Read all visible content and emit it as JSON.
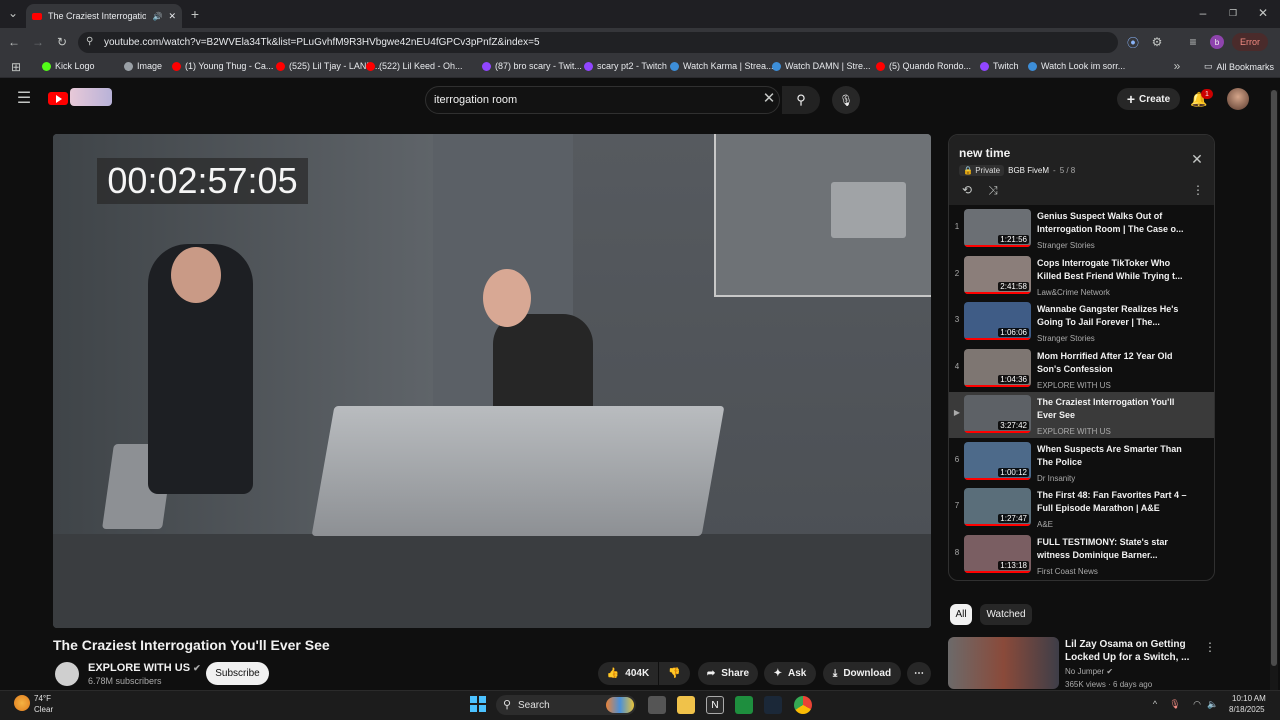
{
  "browser": {
    "tab_title": "The Craziest Interrogation Y",
    "url": "youtube.com/watch?v=B2WVEla34Tk&list=PLuGvhfM9R3HVbgwe42nEU4fGPCv3pPnfZ&index=5",
    "profile_letter": "b",
    "error_label": "Error",
    "bookmarks": [
      {
        "label": "Kick Logo",
        "color": "#53fc18"
      },
      {
        "label": "Image",
        "color": "#9aa0a6"
      },
      {
        "label": "(1) Young Thug - Ca...",
        "color": "#ff0000"
      },
      {
        "label": "(525) Lil Tjay - LANE...",
        "color": "#ff0000"
      },
      {
        "label": "(522) Lil Keed - Oh...",
        "color": "#ff0000"
      },
      {
        "label": "(87) bro scary - Twit...",
        "color": "#9146ff"
      },
      {
        "label": "scary pt2 - Twitch",
        "color": "#9146ff"
      },
      {
        "label": "Watch Karma | Strea...",
        "color": "#3d8ed8"
      },
      {
        "label": "Watch DAMN | Stre...",
        "color": "#3d8ed8"
      },
      {
        "label": "(5) Quando Rondo...",
        "color": "#ff0000"
      },
      {
        "label": "Twitch",
        "color": "#9146ff"
      },
      {
        "label": "Watch Look im sorr...",
        "color": "#3d8ed8"
      }
    ],
    "all_bookmarks": "All Bookmarks"
  },
  "youtube": {
    "search_value": "iterrogation room",
    "create_label": "Create",
    "notification_count": "1"
  },
  "video": {
    "timecode": "00:02:57:05",
    "title": "The Craziest Interrogation You'll Ever See",
    "channel": "EXPLORE WITH US",
    "subscribers": "6.78M subscribers",
    "subscribe_label": "Subscribe",
    "likes": "404K",
    "share_label": "Share",
    "ask_label": "Ask",
    "download_label": "Download"
  },
  "playlist": {
    "title": "new time",
    "privacy": "Private",
    "owner": "BGB FiveM",
    "position": "5 / 8",
    "items": [
      {
        "num": "1",
        "title": "Genius Suspect Walks Out of Interrogation Room | The Case o...",
        "channel": "Stranger Stories",
        "duration": "1:21:56",
        "thumb": "#6b6f74"
      },
      {
        "num": "2",
        "title": "Cops Interrogate TikToker Who Killed Best Friend While Trying t...",
        "channel": "Law&Crime Network",
        "duration": "2:41:58",
        "thumb": "#8b7e7a"
      },
      {
        "num": "3",
        "title": "Wannabe Gangster Realizes He's Going To Jail Forever | The...",
        "channel": "Stranger Stories",
        "duration": "1:06:06",
        "thumb": "#3f5c86"
      },
      {
        "num": "4",
        "title": "Mom Horrified After 12 Year Old Son's Confession",
        "channel": "EXPLORE WITH US",
        "duration": "1:04:36",
        "thumb": "#7e7672"
      },
      {
        "num": "▶",
        "title": "The Craziest Interrogation You'll Ever See",
        "channel": "EXPLORE WITH US",
        "duration": "3:27:42",
        "thumb": "#5d6166",
        "active": true
      },
      {
        "num": "6",
        "title": "When Suspects Are Smarter Than The Police",
        "channel": "Dr Insanity",
        "duration": "1:00:12",
        "thumb": "#4d6a8a"
      },
      {
        "num": "7",
        "title": "The First 48: Fan Favorites Part 4 – Full Episode Marathon | A&E",
        "channel": "A&E",
        "duration": "1:27:47",
        "thumb": "#5a6e7a"
      },
      {
        "num": "8",
        "title": "FULL TESTIMONY: State's star witness Dominique Barner...",
        "channel": "First Coast News",
        "duration": "1:13:18",
        "thumb": "#7a5e62"
      }
    ]
  },
  "filters": [
    "All",
    "Watched"
  ],
  "recommendation": {
    "title": "Lil Zay Osama on Getting Locked Up for a Switch, ...",
    "channel": "No Jumper",
    "stats": "365K views · 6 days ago"
  },
  "taskbar": {
    "temperature": "74°F",
    "condition": "Clear",
    "search_label": "Search",
    "time": "10:10 AM",
    "date": "8/18/2025"
  }
}
